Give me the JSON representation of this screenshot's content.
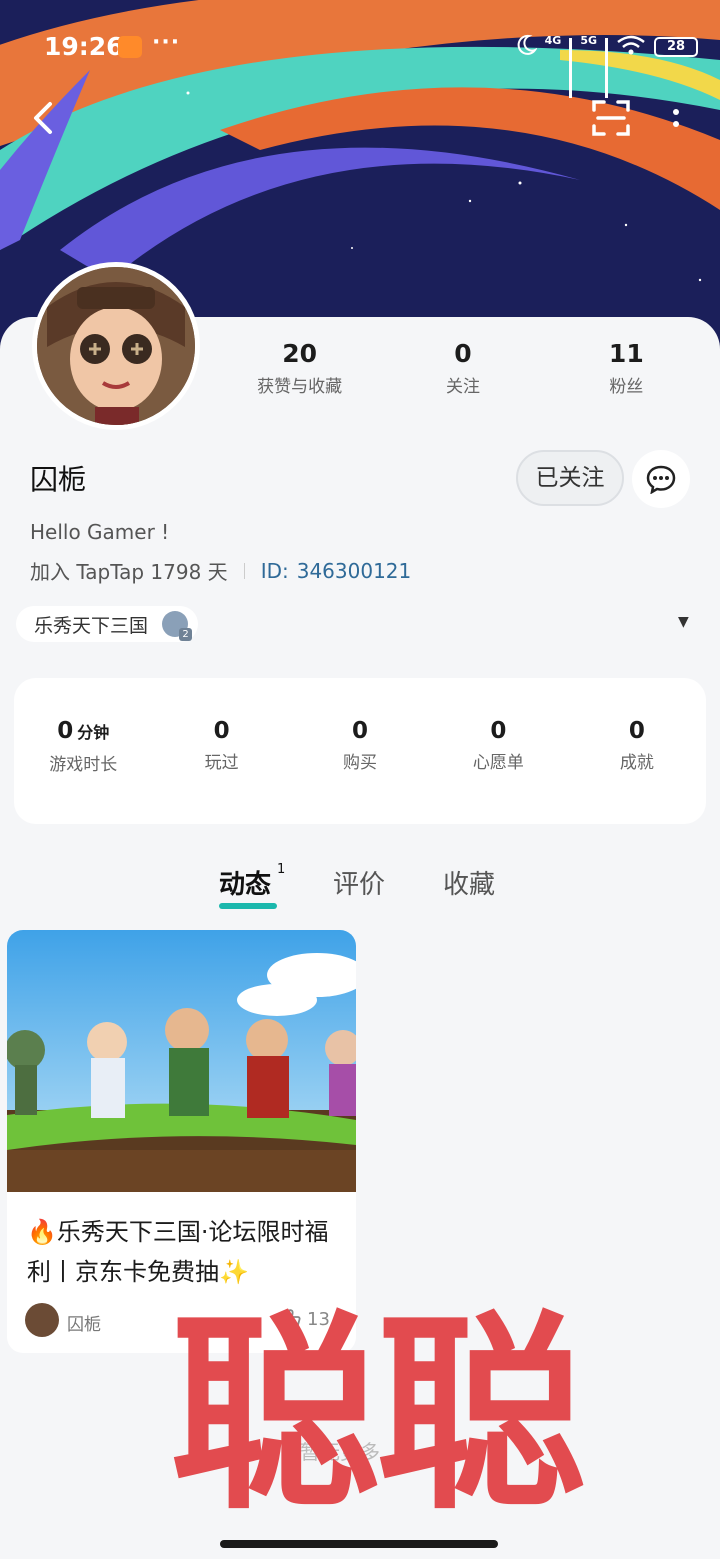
{
  "status_bar": {
    "time": "19:26",
    "more": "···",
    "net_4g": "4G",
    "net_5g": "5G",
    "battery": "28"
  },
  "profile": {
    "username": "囚栀",
    "bio": "Hello Gamer !",
    "joined": "加入 TapTap 1798 天",
    "id_label": "ID:",
    "id_value": "346300121",
    "follow_button": "已关注",
    "stats": [
      {
        "value": "20",
        "label": "获赞与收藏"
      },
      {
        "value": "0",
        "label": "关注"
      },
      {
        "value": "11",
        "label": "粉丝"
      }
    ]
  },
  "game_chip": {
    "name": "乐秀天下三国"
  },
  "game_stats": [
    {
      "value": "0",
      "unit": "分钟",
      "label": "游戏时长"
    },
    {
      "value": "0",
      "unit": "",
      "label": "玩过"
    },
    {
      "value": "0",
      "unit": "",
      "label": "购买"
    },
    {
      "value": "0",
      "unit": "",
      "label": "心愿单"
    },
    {
      "value": "0",
      "unit": "",
      "label": "成就"
    }
  ],
  "tabs": [
    {
      "label": "动态",
      "badge": "1"
    },
    {
      "label": "评价"
    },
    {
      "label": "收藏"
    }
  ],
  "post": {
    "title": "🔥乐秀天下三国·论坛限时福利丨京东卡免费抽✨",
    "author": "囚栀",
    "likes": "13"
  },
  "footer": {
    "no_more": "暂无更多"
  },
  "watermark": "聪聪",
  "colors": {
    "accent": "#1bb8ad",
    "link": "#2f6a98",
    "watermark": "#e24b4f"
  }
}
